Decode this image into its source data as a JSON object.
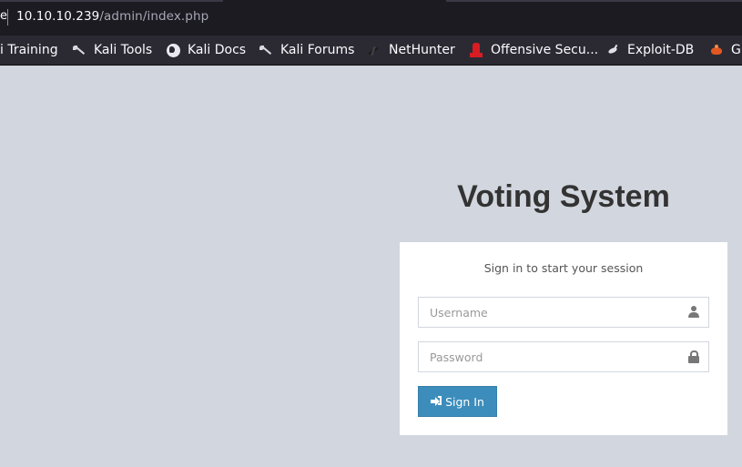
{
  "browser": {
    "url_host": "10.10.10.239",
    "url_path": "/admin/index.php",
    "edge_glyph": "e",
    "bookmarks": [
      {
        "label": "i Training",
        "icon": "none"
      },
      {
        "label": "Kali Tools",
        "icon": "kali-dragon-icon"
      },
      {
        "label": "Kali Docs",
        "icon": "globe-icon"
      },
      {
        "label": "Kali Forums",
        "icon": "kali-dragon-icon"
      },
      {
        "label": "NetHunter",
        "icon": "nethunter-icon"
      },
      {
        "label": "Offensive Secu...",
        "icon": "offsec-icon"
      },
      {
        "label": "Exploit-DB",
        "icon": "exploit-db-icon"
      },
      {
        "label": "G",
        "icon": "ghdb-icon"
      }
    ]
  },
  "login": {
    "title": "Voting System",
    "message": "Sign in to start your session",
    "username_placeholder": "Username",
    "password_placeholder": "Password",
    "signin_label": "Sign In"
  },
  "colors": {
    "page_background": "#d2d6de",
    "button_primary": "#3c8dbc",
    "browser_chrome": "#1c1b22",
    "bookmarks_bar": "#2b2a33"
  }
}
